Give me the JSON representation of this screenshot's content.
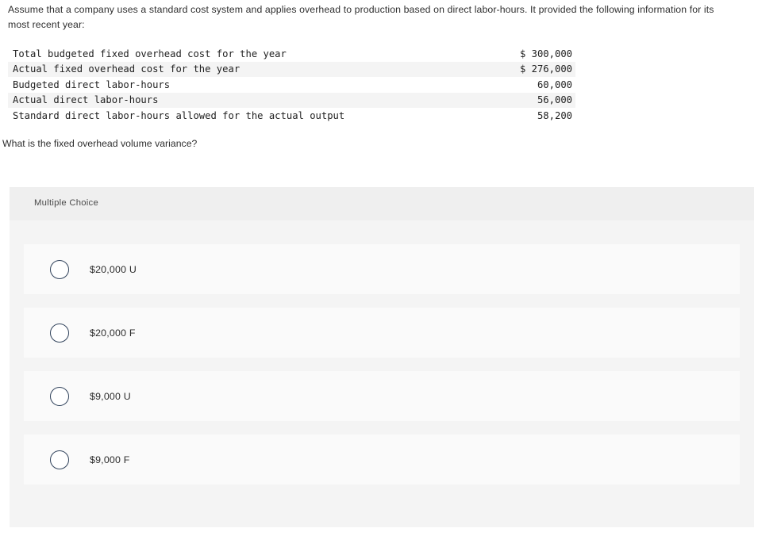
{
  "question": {
    "stem": "Assume that a company uses a standard cost system and applies overhead to production based on direct labor-hours. It provided the following information for its most recent year:",
    "followup": "What is the fixed overhead volume variance?"
  },
  "data_table": {
    "rows": [
      {
        "label": "Total budgeted fixed overhead cost for the year",
        "value": "$ 300,000",
        "striped": false
      },
      {
        "label": "Actual fixed overhead cost for the year",
        "value": "$ 276,000",
        "striped": true
      },
      {
        "label": "Budgeted direct labor-hours",
        "value": "60,000",
        "striped": false
      },
      {
        "label": "Actual direct labor-hours",
        "value": "56,000",
        "striped": true
      },
      {
        "label": "Standard direct labor-hours allowed for the actual output",
        "value": "58,200",
        "striped": false
      }
    ]
  },
  "answer_panel": {
    "type_label": "Multiple Choice",
    "options": [
      {
        "label": "$20,000 U",
        "selected": false
      },
      {
        "label": "$20,000 F",
        "selected": false
      },
      {
        "label": "$9,000 U",
        "selected": false
      },
      {
        "label": "$9,000 F",
        "selected": false
      }
    ]
  },
  "colors": {
    "page_background": "#ffffff",
    "panel_background": "#f4f4f4",
    "panel_header_background": "#efefef",
    "option_card_background": "#fafafa",
    "table_stripe": "#f4f4f4",
    "radio_border": "#31435c",
    "text_primary": "#2b2b2b"
  }
}
